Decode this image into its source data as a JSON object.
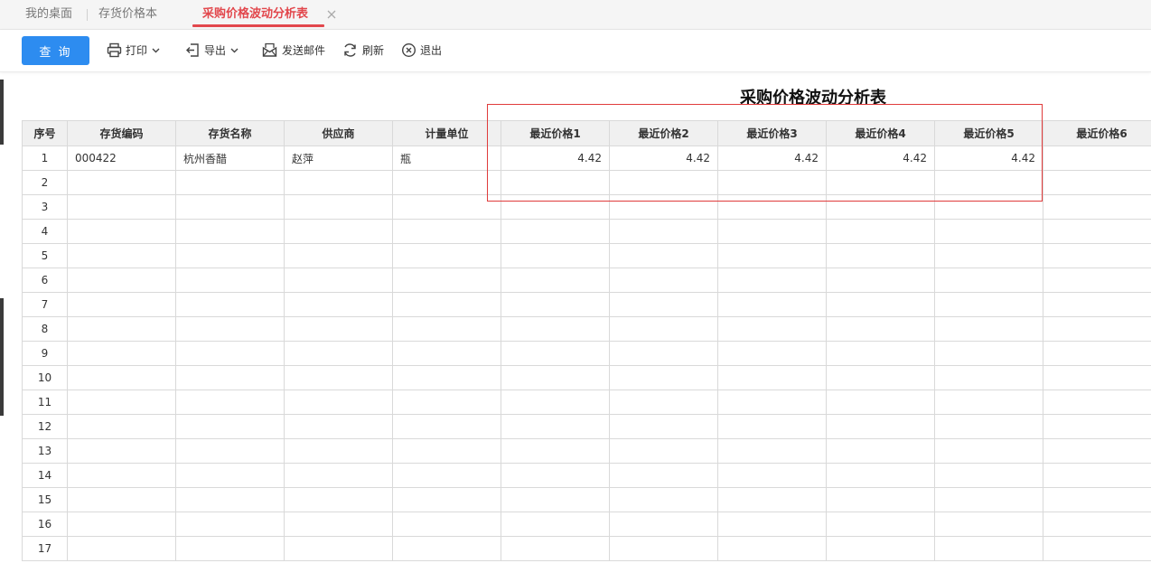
{
  "tabs": [
    {
      "label": "我的桌面",
      "active": false
    },
    {
      "label": "存货价格本",
      "active": false
    },
    {
      "label": "采购价格波动分析表",
      "active": true
    }
  ],
  "toolbar": {
    "query_label": "查 询",
    "print_label": "打印",
    "export_label": "导出",
    "email_label": "发送邮件",
    "refresh_label": "刷新",
    "exit_label": "退出"
  },
  "report": {
    "title": "采购价格波动分析表",
    "columns": [
      "序号",
      "存货编码",
      "存货名称",
      "供应商",
      "计量单位",
      "最近价格1",
      "最近价格2",
      "最近价格3",
      "最近价格4",
      "最近价格5",
      "最近价格6"
    ],
    "rows": [
      [
        "1",
        "000422",
        "杭州香醋",
        "赵萍",
        "瓶",
        "4.42",
        "4.42",
        "4.42",
        "4.42",
        "4.42",
        ""
      ],
      [
        "2",
        "",
        "",
        "",
        "",
        "",
        "",
        "",
        "",
        "",
        ""
      ],
      [
        "3",
        "",
        "",
        "",
        "",
        "",
        "",
        "",
        "",
        "",
        ""
      ],
      [
        "4",
        "",
        "",
        "",
        "",
        "",
        "",
        "",
        "",
        "",
        ""
      ],
      [
        "5",
        "",
        "",
        "",
        "",
        "",
        "",
        "",
        "",
        "",
        ""
      ],
      [
        "6",
        "",
        "",
        "",
        "",
        "",
        "",
        "",
        "",
        "",
        ""
      ],
      [
        "7",
        "",
        "",
        "",
        "",
        "",
        "",
        "",
        "",
        "",
        ""
      ],
      [
        "8",
        "",
        "",
        "",
        "",
        "",
        "",
        "",
        "",
        "",
        ""
      ],
      [
        "9",
        "",
        "",
        "",
        "",
        "",
        "",
        "",
        "",
        "",
        ""
      ],
      [
        "10",
        "",
        "",
        "",
        "",
        "",
        "",
        "",
        "",
        "",
        ""
      ],
      [
        "11",
        "",
        "",
        "",
        "",
        "",
        "",
        "",
        "",
        "",
        ""
      ],
      [
        "12",
        "",
        "",
        "",
        "",
        "",
        "",
        "",
        "",
        "",
        ""
      ],
      [
        "13",
        "",
        "",
        "",
        "",
        "",
        "",
        "",
        "",
        "",
        ""
      ],
      [
        "14",
        "",
        "",
        "",
        "",
        "",
        "",
        "",
        "",
        "",
        ""
      ],
      [
        "15",
        "",
        "",
        "",
        "",
        "",
        "",
        "",
        "",
        "",
        ""
      ],
      [
        "16",
        "",
        "",
        "",
        "",
        "",
        "",
        "",
        "",
        "",
        ""
      ],
      [
        "17",
        "",
        "",
        "",
        "",
        "",
        "",
        "",
        "",
        "",
        ""
      ]
    ]
  },
  "colors": {
    "accent": "#2d8cf0",
    "active_tab": "#e2474c",
    "highlight_border": "#e03b3b",
    "header_bg": "#f0f0f0"
  }
}
